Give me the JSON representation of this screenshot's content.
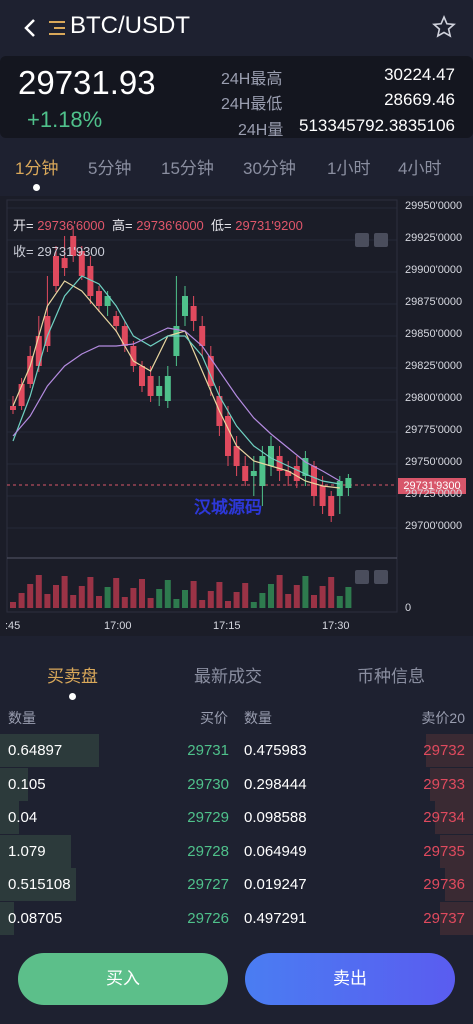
{
  "header": {
    "title": "BTC/USDT",
    "back_icon": "chevron-left-icon",
    "menu_icon": "list-icon",
    "favorite_icon": "star-outline-icon"
  },
  "price": {
    "last": "29731.93",
    "change": "+1.18%",
    "high_label": "24H最高",
    "high_value": "30224.47",
    "low_label": "24H最低",
    "low_value": "28669.46",
    "volume_label": "24H量",
    "volume_value": "513345792.3835106"
  },
  "periods": [
    "1分钟",
    "5分钟",
    "15分钟",
    "30分钟",
    "1小时",
    "4小时"
  ],
  "active_period": "1分钟",
  "ohlc": {
    "open_label": "开=",
    "open_value": "29736'6000",
    "high_label": "高=",
    "high_value": "29736'6000",
    "low_label": "低=",
    "low_value": "29731'9200",
    "close_label": "收=",
    "close_value": "29731'9300"
  },
  "watermark": "汉城源码",
  "current_price_tag": "29731'9300",
  "y_ticks": [
    "29950'0000",
    "29925'0000",
    "29900'0000",
    "29875'0000",
    "29850'0000",
    "29825'0000",
    "29800'0000",
    "29775'0000",
    "29750'0000",
    "29725'0000",
    "29700'0000"
  ],
  "volume_zero": "0",
  "x_ticks": [
    ":45",
    "17:00",
    "17:15",
    "17:30"
  ],
  "colors": {
    "up": "#4fc18b",
    "down": "#e04a5e",
    "accent": "#d9a85a",
    "buy": "#5cbf8a",
    "sell": "#5067f0"
  },
  "tabs": [
    "买卖盘",
    "最新成交",
    "币种信息"
  ],
  "active_tab": "买卖盘",
  "book_headers": {
    "bid_qty": "数量",
    "bid_price": "买价",
    "ask_qty": "数量",
    "ask_price": "卖价20"
  },
  "order_book": [
    {
      "bid_qty": "0.64897",
      "bid_price": "29731",
      "ask_qty": "0.475983",
      "ask_price": "29732",
      "bid_depth": 0.21,
      "ask_depth": 0.1
    },
    {
      "bid_qty": "0.105",
      "bid_price": "29730",
      "ask_qty": "0.298444",
      "ask_price": "29733",
      "bid_depth": 0.06,
      "ask_depth": 0.09
    },
    {
      "bid_qty": "0.04",
      "bid_price": "29729",
      "ask_qty": "0.098588",
      "ask_price": "29734",
      "bid_depth": 0.04,
      "ask_depth": 0.08
    },
    {
      "bid_qty": "1.079",
      "bid_price": "29728",
      "ask_qty": "0.064949",
      "ask_price": "29735",
      "bid_depth": 0.15,
      "ask_depth": 0.07
    },
    {
      "bid_qty": "0.515108",
      "bid_price": "29727",
      "ask_qty": "0.019247",
      "ask_price": "29736",
      "bid_depth": 0.16,
      "ask_depth": 0.06
    },
    {
      "bid_qty": "0.08705",
      "bid_price": "29726",
      "ask_qty": "0.497291",
      "ask_price": "29737",
      "bid_depth": 0.03,
      "ask_depth": 0.07
    }
  ],
  "buttons": {
    "buy": "买入",
    "sell": "卖出"
  }
}
